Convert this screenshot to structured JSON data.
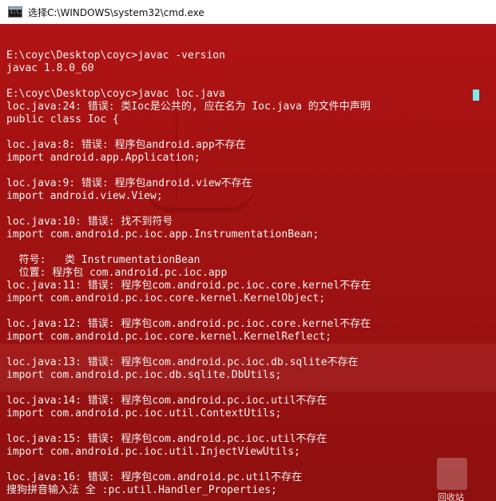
{
  "window": {
    "title": "选择C:\\WINDOWS\\system32\\cmd.exe",
    "icon_text": "C:\\."
  },
  "terminal": {
    "lines": [
      "",
      "E:\\coyc\\Desktop\\coyc>javac -version",
      "javac 1.8.0_60",
      "",
      "E:\\coyc\\Desktop\\coyc>javac loc.java",
      "loc.java:24: 错误: 类Ioc是公共的, 应在名为 Ioc.java 的文件中声明",
      "public class Ioc {",
      "",
      "loc.java:8: 错误: 程序包android.app不存在",
      "import android.app.Application;",
      "",
      "loc.java:9: 错误: 程序包android.view不存在",
      "import android.view.View;",
      "",
      "loc.java:10: 错误: 找不到符号",
      "import com.android.pc.ioc.app.InstrumentationBean;",
      "",
      "  符号:   类 InstrumentationBean",
      "  位置: 程序包 com.android.pc.ioc.app",
      "loc.java:11: 错误: 程序包com.android.pc.ioc.core.kernel不存在",
      "import com.android.pc.ioc.core.kernel.KernelObject;",
      "",
      "loc.java:12: 错误: 程序包com.android.pc.ioc.core.kernel不存在",
      "import com.android.pc.ioc.core.kernel.KernelReflect;",
      "",
      "loc.java:13: 错误: 程序包com.android.pc.ioc.db.sqlite不存在",
      "import com.android.pc.ioc.db.sqlite.DbUtils;",
      "",
      "loc.java:14: 错误: 程序包com.android.pc.ioc.util不存在",
      "import com.android.pc.ioc.util.ContextUtils;",
      "",
      "loc.java:15: 错误: 程序包com.android.pc.ioc.util不存在",
      "import com.android.pc.ioc.util.InjectViewUtils;",
      "",
      "loc.java:16: 错误: 程序包com.android.pc.util不存在",
      "搜狗拼音输入法 全 :pc.util.Handler_Properties;"
    ]
  },
  "desktop": {
    "recycle_bin_label": "回收站"
  },
  "colors": {
    "background": "#a31212",
    "text": "#f2f2f2",
    "cursor": "#7de8e8",
    "titlebar": "#ffffff"
  }
}
